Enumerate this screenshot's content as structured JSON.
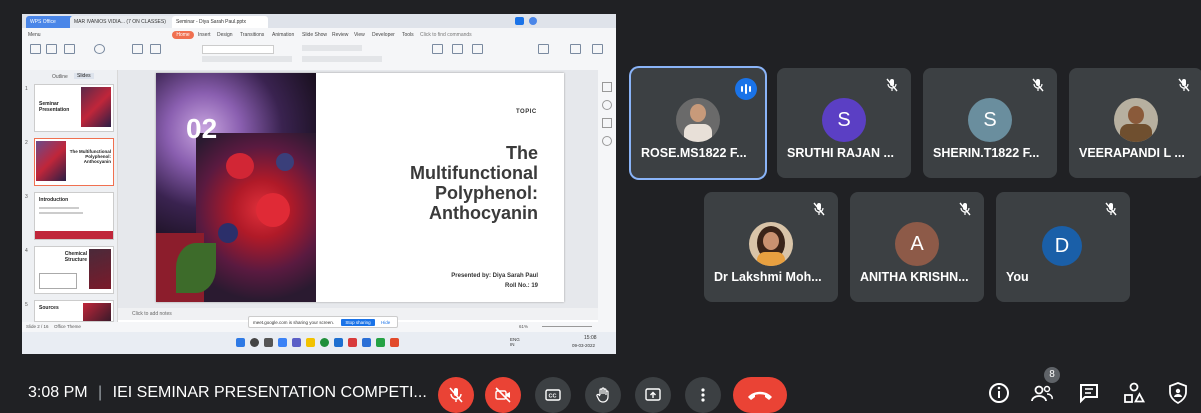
{
  "shared_screen": {
    "tabs": [
      "WPS Office",
      "MAR IVANIOS VIDIA... (7 ON CLASSES)",
      "Seminar - Diya Sarah Paul.pptx"
    ],
    "menu": [
      "Menu",
      "Home",
      "Insert",
      "Design",
      "Transitions",
      "Animation",
      "Slide Show",
      "Review",
      "View",
      "Developer",
      "Tools",
      "Click to find commands"
    ],
    "active_menu": "Home",
    "panel_tabs": [
      "Outline",
      "Slides"
    ],
    "thumbnails": [
      {
        "num": "1",
        "title": "Seminar Presentation"
      },
      {
        "num": "2",
        "title": "The Multifunctional Polyphenol: Anthocyanin"
      },
      {
        "num": "3",
        "title": "Introduction"
      },
      {
        "num": "4",
        "title": "Chemical Structure"
      },
      {
        "num": "5",
        "title": "Sources"
      }
    ],
    "notes_placeholder": "Click to add notes",
    "status_left": "Slide 2 / 16",
    "status_theme": "Office Theme",
    "zoom": "61%",
    "share_banner": "meet.google.com is sharing your screen.",
    "stop_sharing": "Stop sharing",
    "hide": "Hide",
    "clock_time": "15:08",
    "clock_date": "09-03-2022",
    "lang": "ENG IN",
    "slide": {
      "number": "02",
      "topic_label": "TOPIC",
      "title_lines": [
        "The",
        "Multifunctional",
        "Polyphenol:",
        "Anthocyanin"
      ],
      "presenter": "Presented by: Diya Sarah Paul",
      "roll": "Roll No.: 19"
    }
  },
  "participants": [
    {
      "name": "ROSE.MS1822 F...",
      "initial": "",
      "avatar_color": "#5f6368",
      "active_speaker": true
    },
    {
      "name": "SRUTHI RAJAN ...",
      "initial": "S",
      "avatar_color": "#5b3fc4",
      "active_speaker": false
    },
    {
      "name": "SHERIN.T1822 F...",
      "initial": "S",
      "avatar_color": "#6a8e9e",
      "active_speaker": false
    },
    {
      "name": "VEERAPANDI L ...",
      "initial": "",
      "avatar_color": "#b08a5a",
      "active_speaker": false
    },
    {
      "name": "Dr Lakshmi Moh...",
      "initial": "",
      "avatar_color": "#c9a27a",
      "active_speaker": false
    },
    {
      "name": "ANITHA KRISHN...",
      "initial": "A",
      "avatar_color": "#8d5a48",
      "active_speaker": false
    },
    {
      "name": "You",
      "initial": "D",
      "avatar_color": "#1a5fa8",
      "active_speaker": false
    }
  ],
  "meeting": {
    "time": "3:08 PM",
    "separator": "|",
    "title": "IEI SEMINAR PRESENTATION COMPETI...",
    "participant_count": "8"
  },
  "colors": {
    "background": "#202124",
    "tile": "#3c4043",
    "danger": "#ea4335",
    "accent": "#1a73e8"
  },
  "icons": [
    "mic-off-icon",
    "camera-off-icon",
    "captions-icon",
    "raise-hand-icon",
    "present-icon",
    "more-icon",
    "end-call-icon",
    "info-icon",
    "people-icon",
    "chat-icon",
    "activities-icon",
    "host-controls-icon"
  ]
}
